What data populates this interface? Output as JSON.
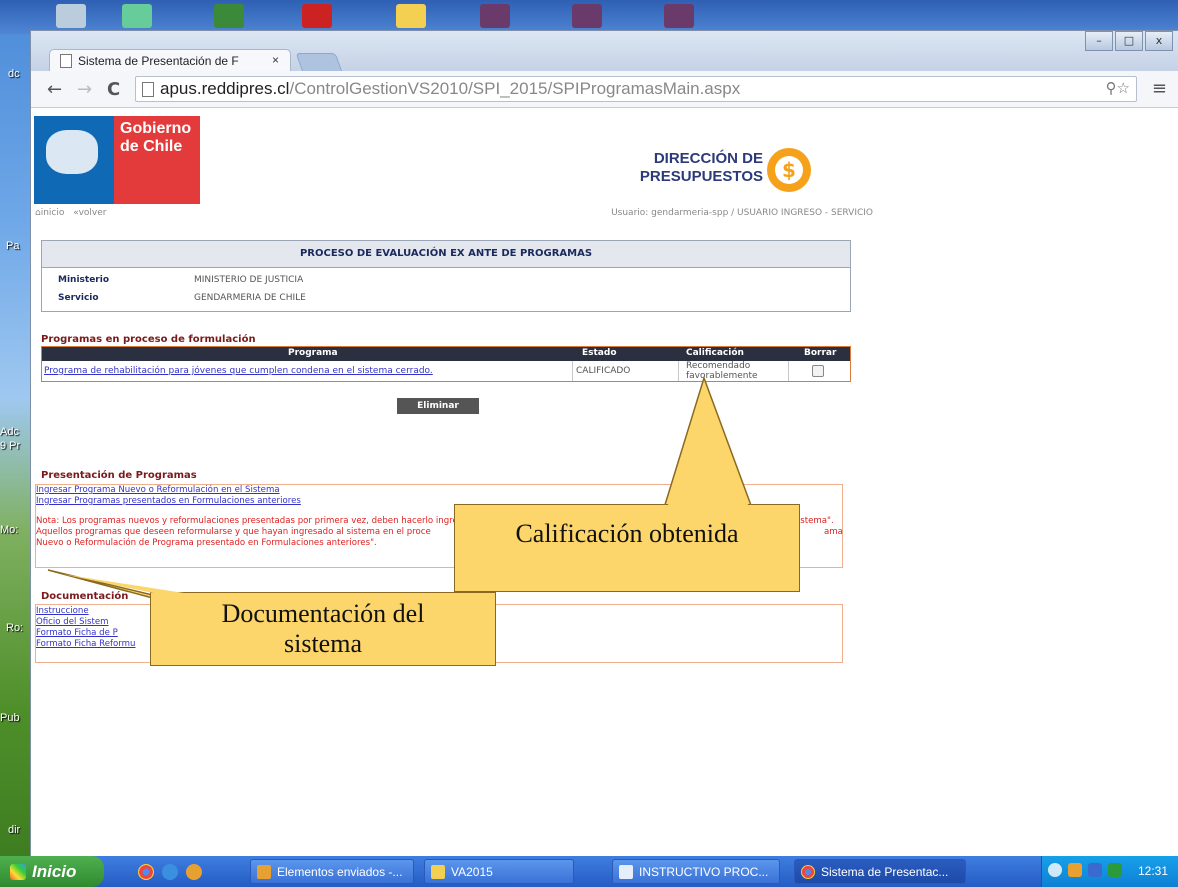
{
  "desktop": {
    "side_labels": [
      "dc",
      "Pa",
      "Adc",
      "9 Pr",
      "Mo:",
      "Ro:",
      "Pub",
      "dir"
    ]
  },
  "browser": {
    "tab_title": "Sistema de Presentación de F",
    "tab_close": "×",
    "url_host": "apus.reddipres.cl",
    "url_path": "/ControlGestionVS2010/SPI_2015/SPIProgramasMain.aspx",
    "window_buttons": [
      "–",
      "□",
      "x"
    ]
  },
  "header": {
    "gobierno_line1": "Gobierno",
    "gobierno_line2": "de Chile",
    "dipres_line1": "DIRECCIÓN DE",
    "dipres_line2": "PRESUPUESTOS",
    "nav_inicio": "⌂inicio",
    "nav_volver": "«volver",
    "user_info": "Usuario: gendarmeria-spp / USUARIO INGRESO - SERVICIO"
  },
  "process": {
    "title": "PROCESO DE EVALUACIÓN EX ANTE DE PROGRAMAS",
    "ministerio_label": "Ministerio",
    "ministerio_value": "MINISTERIO DE JUSTICIA",
    "servicio_label": "Servicio",
    "servicio_value": "GENDARMERIA DE CHILE"
  },
  "programs": {
    "section_title": "Programas en proceso de formulación",
    "columns": [
      "Programa",
      "Estado",
      "Calificación",
      "Borrar"
    ],
    "rows": [
      {
        "programa": "Programa de rehabilitación para jóvenes que cumplen condena en el sistema cerrado.",
        "estado": "CALIFICADO",
        "calificacion": "Recomendado favorablemente"
      }
    ],
    "delete_button": "Eliminar"
  },
  "presentation": {
    "section_title": "Presentación de Programas",
    "link1": "Ingresar Programa Nuevo o Reformulación en el Sistema",
    "link2": "Ingresar Programas presentados en Formulaciones anteriores",
    "note_line1": "Nota: Los programas nuevos y reformulaciones presentadas por primera vez, deben hacerlo ingresando al link \"Ingresar Programa N",
    "note_line1_end": "ción en el Sistema\".",
    "note_line2": "Aquellos programas que deseen reformularse y que hayan ingresado al sistema en el proce",
    "note_line2_end": "ama",
    "note_line3": "Nuevo o Reformulación de Programa presentado en Formulaciones anteriores\"."
  },
  "documentation": {
    "section_title": "Documentación",
    "links": [
      "Instruccione",
      "Oficio del Sistem",
      "Formato Ficha de P",
      "Formato Ficha Reformu"
    ]
  },
  "callouts": {
    "calificacion": "Calificación obtenida",
    "documentacion_line1": "Documentación del",
    "documentacion_line2": "sistema"
  },
  "taskbar": {
    "start": "Inicio",
    "tasks": [
      "Elementos enviados -...",
      "VA2015",
      "INSTRUCTIVO PROC...",
      "Sistema de Presentac..."
    ],
    "clock": "12:31"
  }
}
